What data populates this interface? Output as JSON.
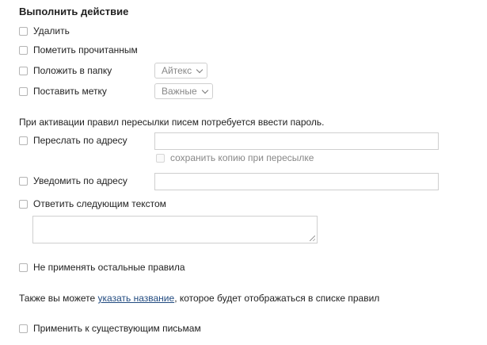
{
  "section_title": "Выполнить действие",
  "actions": {
    "delete_label": "Удалить",
    "mark_read_label": "Пометить прочитанным",
    "move_to_folder_label": "Положить в папку",
    "folder_select_value": "Айтекс",
    "set_label_label": "Поставить метку",
    "label_select_value": "Важные"
  },
  "forward_note": "При активации правил пересылки писем потребуется ввести пароль.",
  "forward": {
    "label": "Переслать по адресу",
    "address_value": "",
    "keep_copy_label": "сохранить копию при пересылке"
  },
  "notify": {
    "label": "Уведомить по адресу",
    "address_value": ""
  },
  "reply": {
    "label": "Ответить следующим текстом",
    "text_value": ""
  },
  "stop_rules_label": "Не применять остальные правила",
  "name_hint": {
    "prefix": "Также вы можете ",
    "link": "указать название",
    "suffix": ", которое будет отображаться в списке правил"
  },
  "apply_existing_label": "Применить к существующим письмам"
}
